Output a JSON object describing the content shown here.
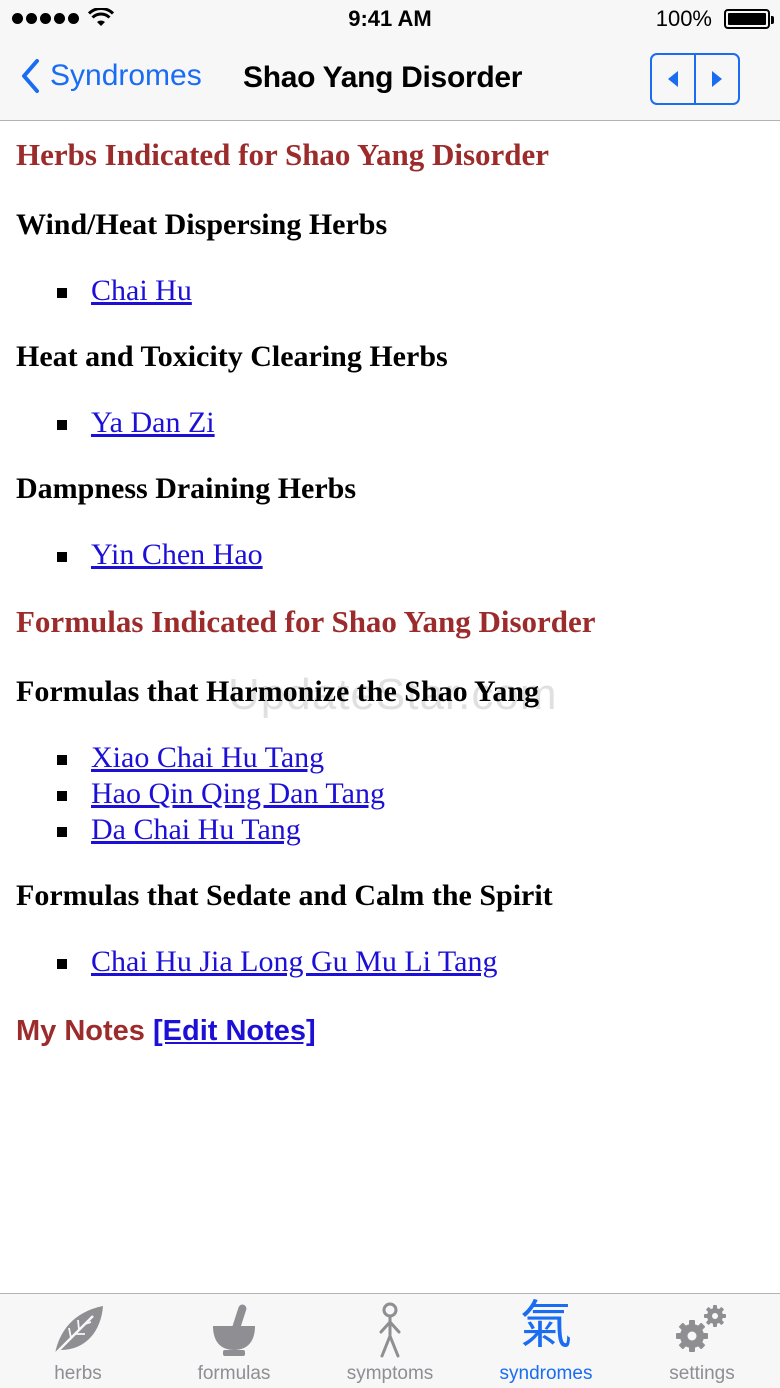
{
  "status": {
    "time": "9:41 AM",
    "battery": "100%"
  },
  "nav": {
    "back_label": "Syndromes",
    "title": "Shao Yang Disorder"
  },
  "content": {
    "herbs_heading": "Herbs Indicated for Shao Yang Disorder",
    "herb_groups": [
      {
        "category": "Wind/Heat Dispersing Herbs",
        "items": [
          "Chai Hu"
        ]
      },
      {
        "category": "Heat and Toxicity Clearing Herbs",
        "items": [
          "Ya Dan Zi"
        ]
      },
      {
        "category": "Dampness Draining Herbs",
        "items": [
          "Yin Chen Hao"
        ]
      }
    ],
    "formulas_heading": "Formulas Indicated for Shao Yang Disorder",
    "formula_groups": [
      {
        "category": "Formulas that Harmonize the Shao Yang",
        "items": [
          "Xiao Chai Hu Tang",
          "Hao Qin Qing Dan Tang",
          "Da Chai Hu Tang"
        ]
      },
      {
        "category": "Formulas that Sedate and Calm the Spirit",
        "items": [
          "Chai Hu Jia Long Gu Mu Li Tang"
        ]
      }
    ],
    "notes_label": "My Notes",
    "edit_notes_link": "[Edit Notes]"
  },
  "watermark": "UpdateStar.com",
  "tabs": [
    {
      "label": "herbs",
      "icon": "leaf-icon"
    },
    {
      "label": "formulas",
      "icon": "mortar-pestle-icon"
    },
    {
      "label": "symptoms",
      "icon": "stick-figure-icon"
    },
    {
      "label": "syndromes",
      "icon": "qi-character-icon",
      "glyph": "氣"
    },
    {
      "label": "settings",
      "icon": "gears-icon"
    }
  ],
  "colors": {
    "accent": "#1a6cf2",
    "heading": "#9c2b2b",
    "link": "#1c0fd6"
  }
}
